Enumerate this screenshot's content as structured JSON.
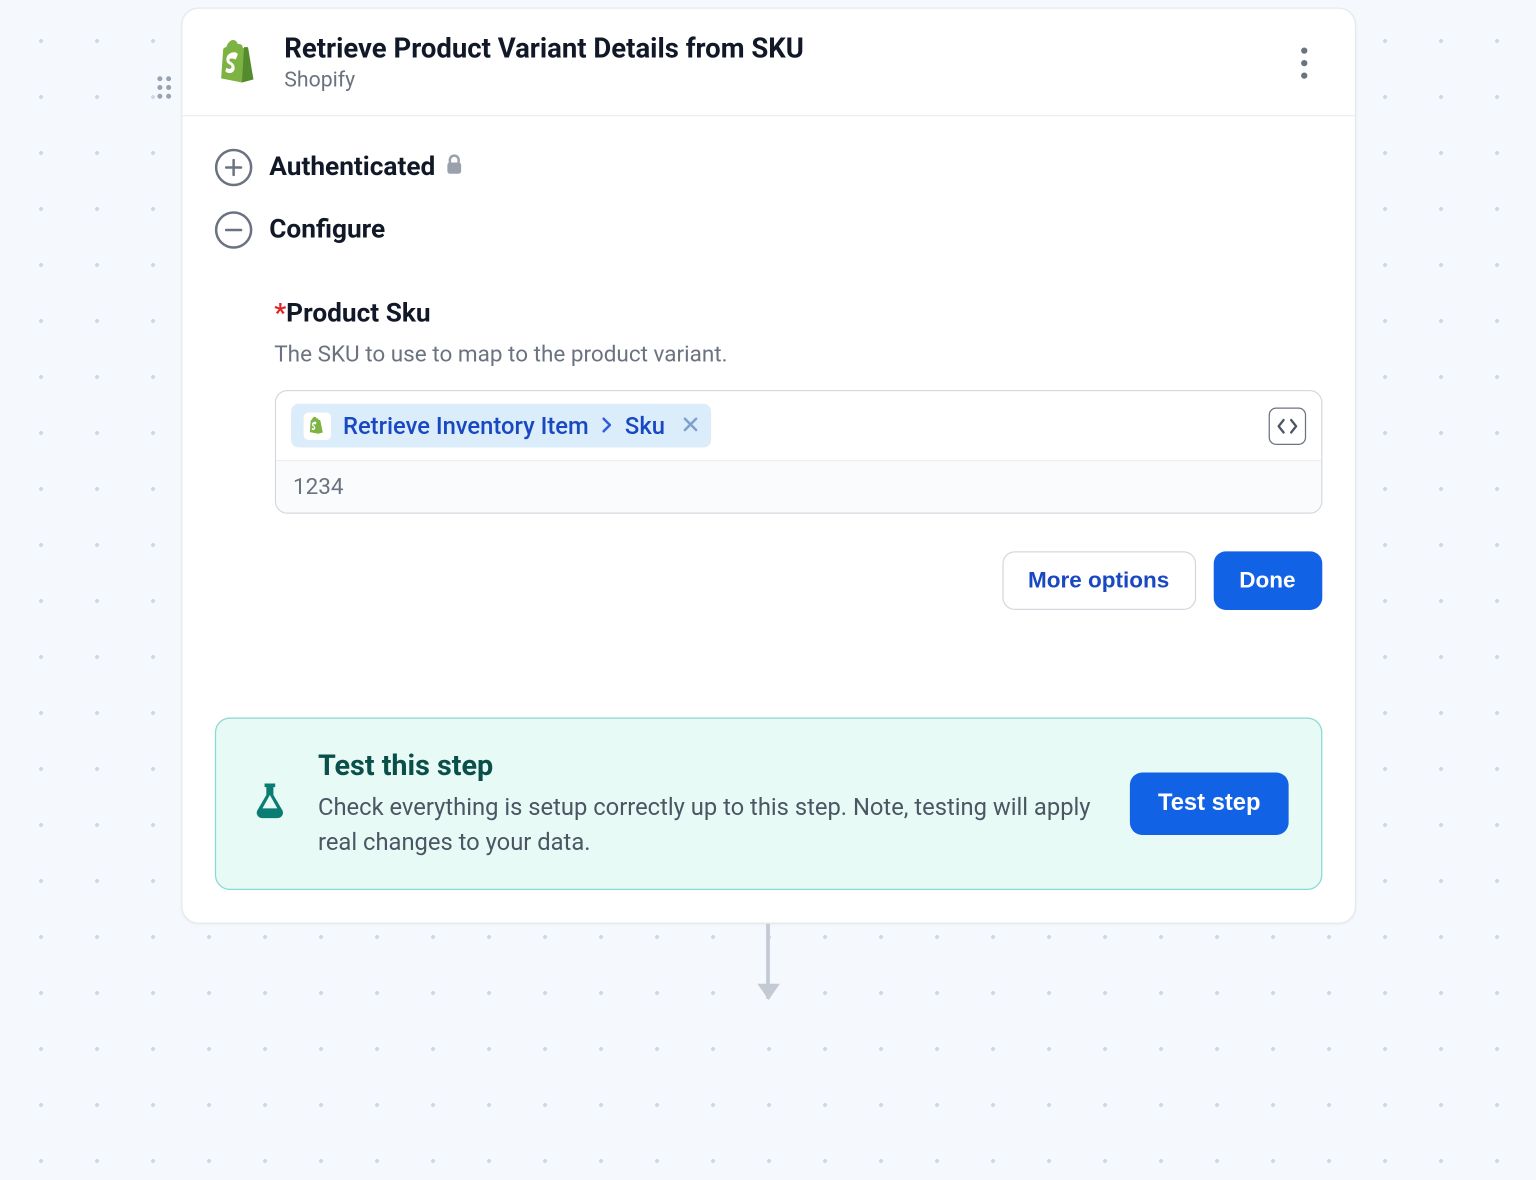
{
  "header": {
    "title": "Retrieve Product Variant Details from SKU",
    "subtitle": "Shopify"
  },
  "sections": {
    "authenticated_label": "Authenticated",
    "configure_label": "Configure"
  },
  "field": {
    "label": "Product Sku",
    "description": "The SKU to use to map to the product variant.",
    "pill_source": "Retrieve Inventory Item",
    "pill_field": "Sku",
    "resolved_value": "1234"
  },
  "actions": {
    "more_options": "More options",
    "done": "Done"
  },
  "test": {
    "title": "Test this step",
    "description": "Check everything is setup correctly up to this step. Note, testing will apply real changes to your data.",
    "button": "Test step"
  }
}
